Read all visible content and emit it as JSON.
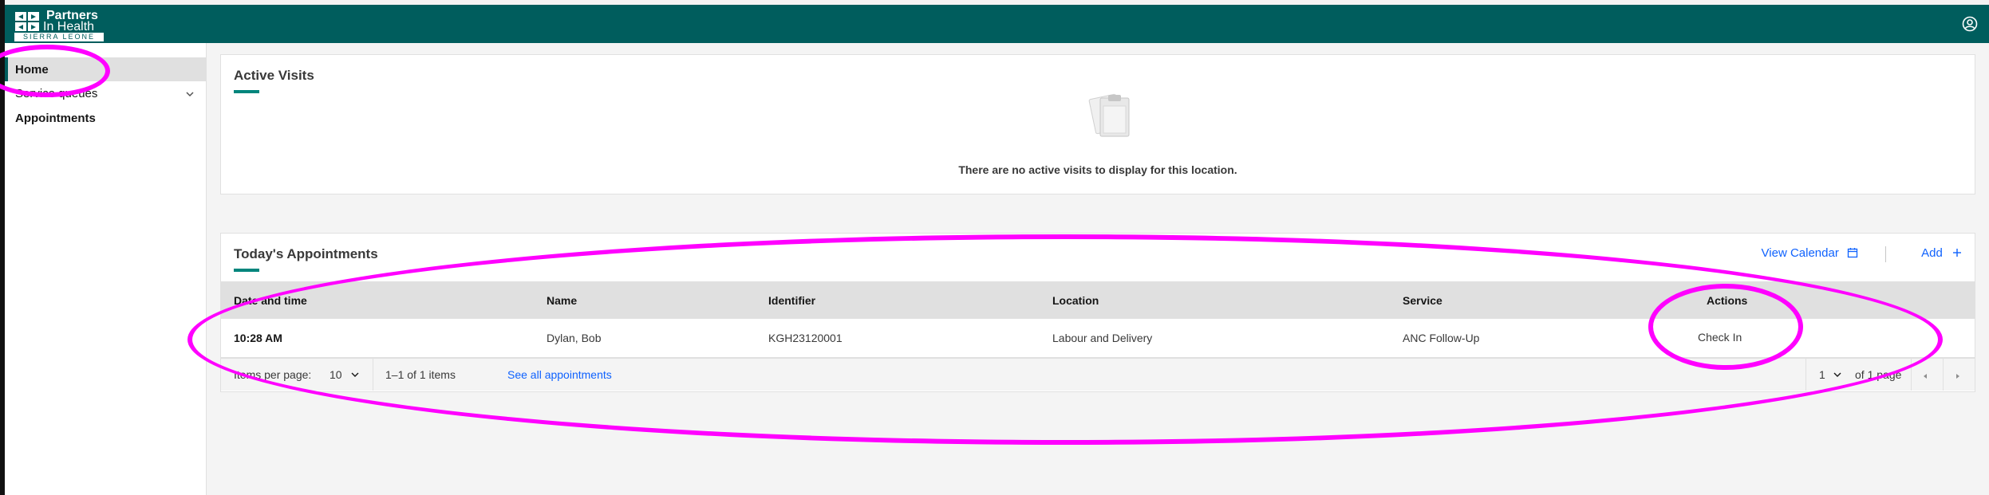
{
  "brand": {
    "line1": "Partners",
    "line2": "In Health",
    "line3": "SIERRA LEONE",
    "color": "#005d5d"
  },
  "header": {
    "user_icon": "user-avatar-icon"
  },
  "sidebar": {
    "items": [
      {
        "label": "Home",
        "active": true
      },
      {
        "label": "Service queues",
        "icon": "chevron-down-icon"
      },
      {
        "label": "Appointments"
      }
    ]
  },
  "active_visits": {
    "title": "Active Visits",
    "empty_message": "There are no active visits to display for this location."
  },
  "appointments": {
    "title": "Today's Appointments",
    "view_calendar": "View Calendar",
    "add": "Add",
    "columns": [
      "Date and time",
      "Name",
      "Identifier",
      "Location",
      "Service",
      "Actions"
    ],
    "rows": [
      {
        "time": "10:28 AM",
        "name": "Dylan, Bob",
        "identifier": "KGH23120001",
        "location": "Labour and Delivery",
        "service": "ANC Follow-Up",
        "action": "Check In"
      }
    ],
    "pagination": {
      "items_per_page_label": "Items per page:",
      "items_per_page": "10",
      "range": "1–1 of 1 items",
      "see_all": "See all appointments",
      "page": "1",
      "of_pages": "of 1 page"
    }
  },
  "accent": "#00857c",
  "link_color": "#0f62fe",
  "annotation_color": "#ff00ff"
}
